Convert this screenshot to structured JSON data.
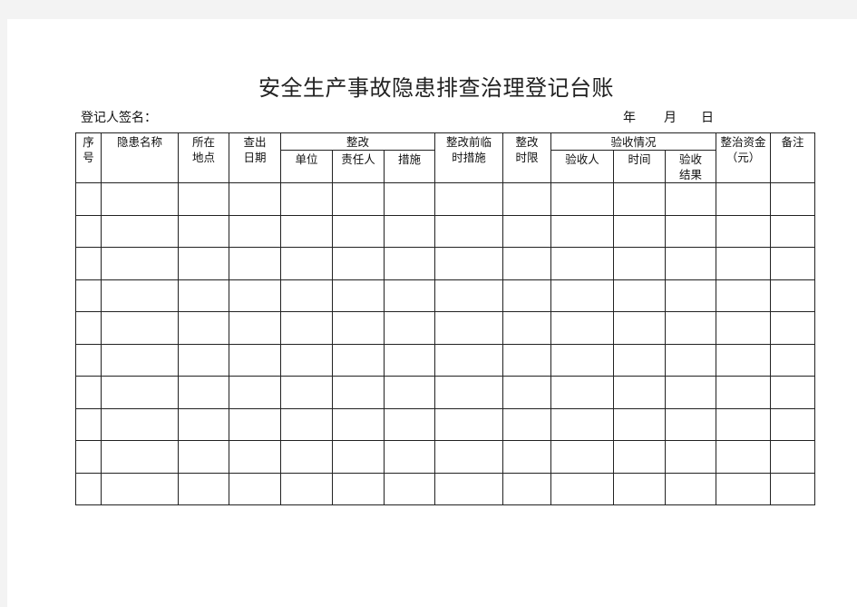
{
  "document": {
    "title": "安全生产事故隐患排查治理登记台账",
    "signer_label": "登记人签名：",
    "date": {
      "year": "年",
      "month": "月",
      "day": "日"
    }
  },
  "table": {
    "headers": {
      "seq": "序号",
      "hazard_name": "隐患名称",
      "location": "所在地点",
      "check_date": "查出日期",
      "rectify": "整改",
      "rectify_sub": {
        "unit": "单位",
        "responsible": "责任人",
        "measures": "措施"
      },
      "temp_measures": "整改前临时措施",
      "deadline": "整改时限",
      "acceptance": "验收情况",
      "acceptance_sub": {
        "inspector": "验收人",
        "time": "时间",
        "result": "验收结果"
      },
      "funds": "整治资金（元）",
      "remarks": "备注"
    },
    "row_count": 10
  }
}
